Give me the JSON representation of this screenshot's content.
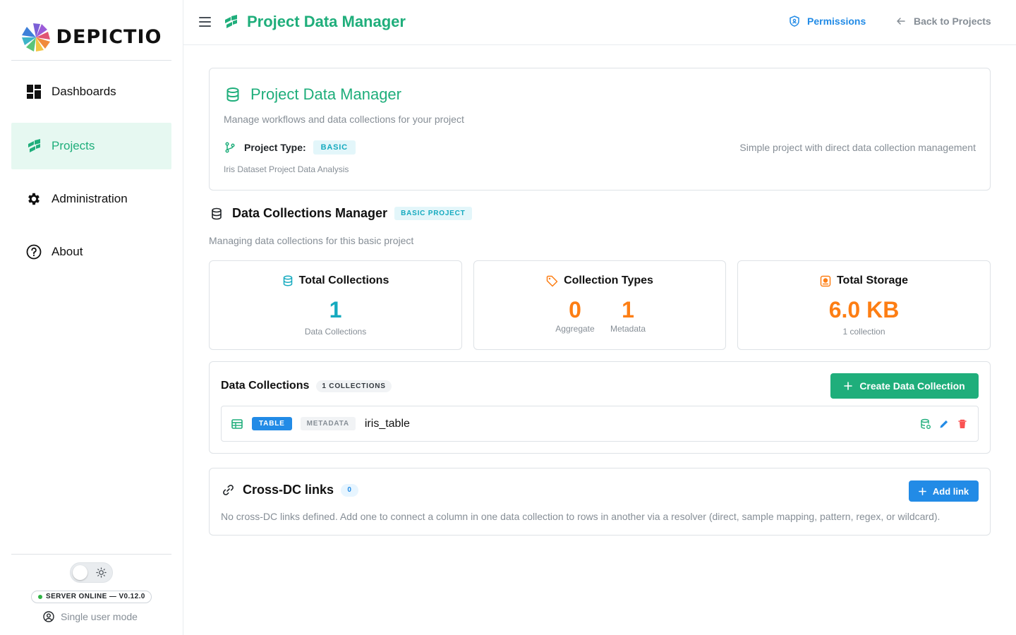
{
  "app": {
    "logo_text": "DEPICTIO"
  },
  "sidebar": {
    "items": [
      {
        "label": "Dashboards",
        "icon": "dashboard-icon",
        "active": false
      },
      {
        "label": "Projects",
        "icon": "projects-icon",
        "active": true
      },
      {
        "label": "Administration",
        "icon": "gear-icon",
        "active": false
      },
      {
        "label": "About",
        "icon": "help-circle-icon",
        "active": false
      }
    ],
    "theme_toggle": {
      "state": "light"
    },
    "server_status": "SERVER ONLINE — V0.12.0",
    "user_mode": "Single user mode"
  },
  "header": {
    "title": "Project Data Manager",
    "permissions_label": "Permissions",
    "back_label": "Back to Projects"
  },
  "project_card": {
    "title": "Project Data Manager",
    "description": "Manage workflows and data collections for your project",
    "type_label": "Project Type:",
    "type_badge": "BASIC",
    "type_note": "Simple project with direct data collection management",
    "project_name": "Iris Dataset Project Data Analysis"
  },
  "collections_manager": {
    "title": "Data Collections Manager",
    "badge": "BASIC PROJECT",
    "description": "Managing data collections for this basic project"
  },
  "stats": {
    "total_collections": {
      "title": "Total Collections",
      "value": "1",
      "caption": "Data Collections"
    },
    "collection_types": {
      "title": "Collection Types",
      "aggregate_value": "0",
      "aggregate_label": "Aggregate",
      "metadata_value": "1",
      "metadata_label": "Metadata"
    },
    "total_storage": {
      "title": "Total Storage",
      "value": "6.0 KB",
      "caption": "1 collection"
    }
  },
  "data_collections": {
    "title": "Data Collections",
    "count_badge": "1 COLLECTIONS",
    "create_label": "Create Data Collection",
    "rows": [
      {
        "type_badge": "TABLE",
        "meta_badge": "METADATA",
        "name": "iris_table"
      }
    ]
  },
  "cross_dc": {
    "title": "Cross-DC links",
    "count": "0",
    "add_label": "Add link",
    "description": "No cross-DC links defined. Add one to connect a column in one data collection to rows in another via a resolver (direct, sample mapping, pattern, regex, or wildcard)."
  },
  "colors": {
    "brand_green": "#1fae7b",
    "cyan": "#15aabf",
    "orange": "#fd7e14",
    "blue": "#228be6",
    "red": "#fa5252"
  }
}
